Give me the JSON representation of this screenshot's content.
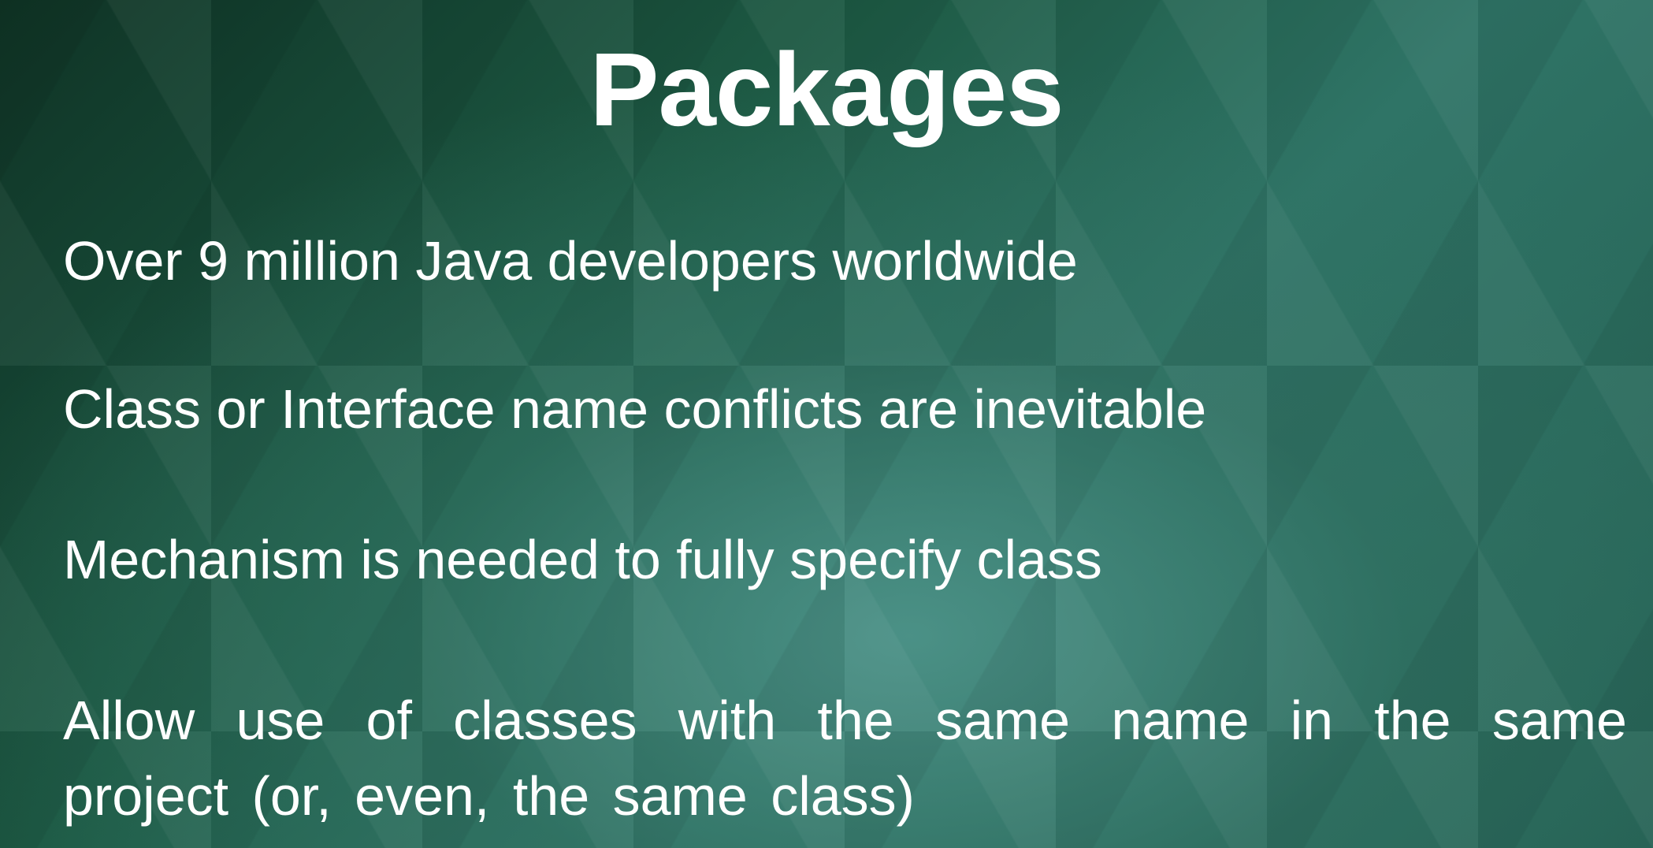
{
  "slide": {
    "title": "Packages",
    "bullets": [
      "Over 9 million Java developers worldwide",
      "Class or Interface name conflicts are inevitable",
      "Mechanism is needed to fully specify class",
      "Allow use of classes with the same name in the same project (or, even, the same class)"
    ]
  },
  "colors": {
    "background_dark": "#0f3325",
    "background_light": "#3a8074",
    "text": "#ffffff"
  }
}
